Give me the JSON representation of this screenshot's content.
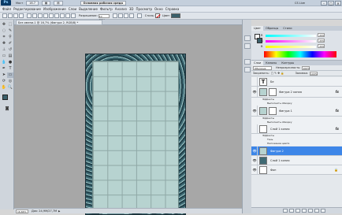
{
  "titlebar": {
    "logo": "Ps",
    "mini_label": "Мост",
    "zoom": "16.7",
    "workspace_label": "Основная рабочая среда",
    "cslive_label": "CS Live",
    "window_controls": [
      "–",
      "□",
      "✕"
    ]
  },
  "menubar": {
    "items": [
      "Файл",
      "Редактирование",
      "Изображение",
      "Слои",
      "Выделение",
      "Фильтр",
      "Анализ",
      "3D",
      "Просмотр",
      "Окно",
      "Справка"
    ]
  },
  "options": {
    "width_label": "Разрешение:",
    "width_value": "10 пикс",
    "style_label": "Стиль:",
    "color_label": "Цвет:",
    "color_swatch": "#3a5f6a"
  },
  "document": {
    "tab_title": "Без имени-1 @ 16,7% (Фигура 2, RGB/8) *"
  },
  "status": {
    "zoom": "16,66%",
    "doc_info": "Док: 24,9М/27,7М"
  },
  "color_panel": {
    "tabs": [
      "Цвет",
      "Образцы",
      "Стили"
    ],
    "channels": [
      {
        "label": "R",
        "value": "255"
      },
      {
        "label": "G",
        "value": "255"
      },
      {
        "label": "B",
        "value": "255"
      }
    ]
  },
  "layers_panel": {
    "tabs": [
      "Слои",
      "Каналы",
      "Контуры"
    ],
    "blend_mode": "Обычные",
    "opacity_label": "Непрозрачность:",
    "opacity_value": "100%",
    "lock_label": "Закрепить:",
    "fill_label": "Заливка:",
    "fill_value": "100%",
    "layers": [
      {
        "name": "Бе",
        "selected": false
      },
      {
        "name": "Фигура 2 копия",
        "selected": false,
        "fx": "fx",
        "effects_label": "Эффекты",
        "effects": [
          "Выполнить обводку"
        ]
      },
      {
        "name": "Фигура 1",
        "selected": false,
        "fx": "fx",
        "effects_label": "Эффекты",
        "effects": [
          "Выполнить обводку"
        ]
      },
      {
        "name": "Слой 1 копия",
        "selected": false,
        "fx": "fx",
        "effects_label": "Эффекты",
        "effects": [
          "Тень",
          "Наложение цвета"
        ]
      },
      {
        "name": "Фигура 2",
        "selected": true
      },
      {
        "name": "Слой 1 копия",
        "selected": false
      },
      {
        "name": "Фон",
        "selected": false,
        "locked": true
      }
    ]
  },
  "colors": {
    "accent": "#3d86e8",
    "canvas_bg": "#a7a7a7",
    "doc_fill": "#b7d3d0",
    "border_dark": "#2e4d59"
  }
}
